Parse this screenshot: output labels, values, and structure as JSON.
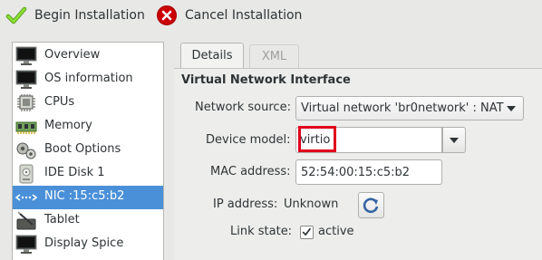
{
  "toolbar": {
    "begin_label": "Begin Installation",
    "begin_icon": "checkmark-icon",
    "cancel_label": "Cancel Installation",
    "cancel_icon": "cancel-icon"
  },
  "sidebar": {
    "items": [
      {
        "label": "Overview",
        "icon": "monitor-icon"
      },
      {
        "label": "OS information",
        "icon": "monitor-icon"
      },
      {
        "label": "CPUs",
        "icon": "cpu-icon"
      },
      {
        "label": "Memory",
        "icon": "memory-icon"
      },
      {
        "label": "Boot Options",
        "icon": "gears-icon"
      },
      {
        "label": "IDE Disk 1",
        "icon": "disk-icon"
      },
      {
        "label": "NIC :15:c5:b2",
        "icon": "network-icon",
        "selected": true
      },
      {
        "label": "Tablet",
        "icon": "tablet-icon"
      },
      {
        "label": "Display Spice",
        "icon": "monitor-icon"
      }
    ]
  },
  "tabs": {
    "details": "Details",
    "xml": "XML",
    "active": "Details"
  },
  "panel": {
    "title": "Virtual Network Interface",
    "network_source_label": "Network source:",
    "network_source_value": "Virtual network 'br0network' : NAT",
    "device_model_label": "Device model:",
    "device_model_value": "virtio",
    "mac_label": "MAC address:",
    "mac_value": "52:54:00:15:c5:b2",
    "ip_label": "IP address:",
    "ip_value": "Unknown",
    "link_state_label": "Link state:",
    "link_state_checked": true,
    "link_state_value": "active"
  },
  "colors": {
    "selection": "#4a90d9",
    "highlight_box": "#e0001b",
    "check_green": "#73d216",
    "cancel_red": "#cc0000"
  }
}
